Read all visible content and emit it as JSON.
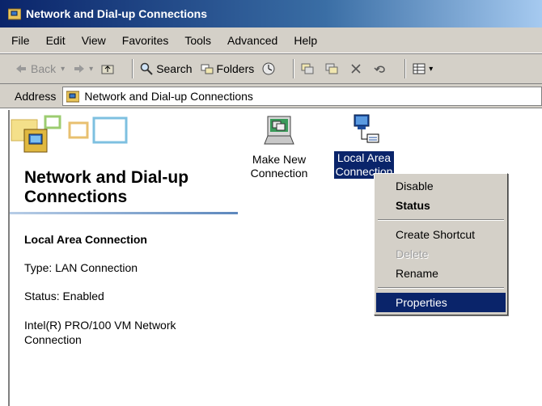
{
  "window": {
    "title": "Network and Dial-up Connections"
  },
  "menubar": {
    "items": [
      "File",
      "Edit",
      "View",
      "Favorites",
      "Tools",
      "Advanced",
      "Help"
    ]
  },
  "toolbar": {
    "back_label": "Back",
    "search_label": "Search",
    "folders_label": "Folders"
  },
  "address": {
    "label": "Address",
    "value": "Network and Dial-up Connections"
  },
  "panel": {
    "heading": "Network and Dial-up Connections",
    "selected_name": "Local Area Connection",
    "type_text": "Type: LAN Connection",
    "status_text": "Status: Enabled",
    "device_text": "Intel(R) PRO/100 VM Network Connection"
  },
  "icons": {
    "make_new": {
      "line1": "Make New",
      "line2": "Connection"
    },
    "local_area": {
      "line1": "Local Area",
      "line2": "Connection"
    }
  },
  "context_menu": {
    "disable": "Disable",
    "status": "Status",
    "create_shortcut": "Create Shortcut",
    "delete": "Delete",
    "rename": "Rename",
    "properties": "Properties"
  },
  "colors": {
    "selection": "#0a246a",
    "chrome": "#d4d0c8"
  }
}
